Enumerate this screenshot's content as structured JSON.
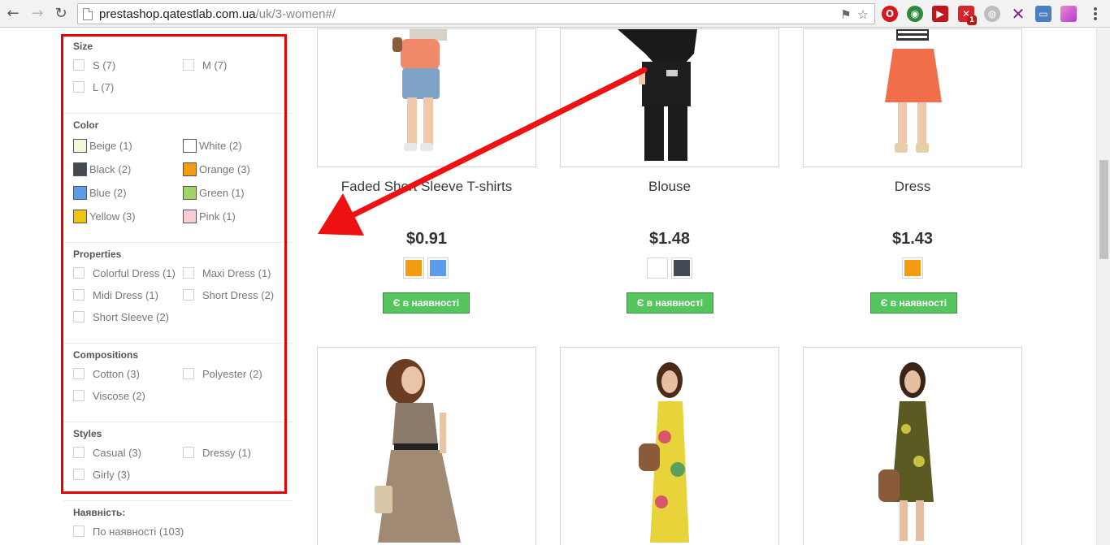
{
  "browser": {
    "url_host": "prestashop.qatestlab.com.ua",
    "url_path": "/uk/3-women#/",
    "back_icon": "arrow-left-icon",
    "forward_icon": "arrow-right-icon",
    "reload_icon": "reload-icon",
    "extensions": [
      {
        "name": "opera-extension-icon",
        "glyph": "O",
        "color": "#d9141d"
      },
      {
        "name": "globe-extension-icon",
        "glyph": "●",
        "color": "#2e8b3e"
      },
      {
        "name": "media-extension-icon",
        "glyph": "▶",
        "color": "#c0171f"
      },
      {
        "name": "blocker-extension-icon",
        "glyph": "✕",
        "color": "#d6252b"
      },
      {
        "name": "world-extension-icon",
        "glyph": "◍",
        "color": "#8a8a8a"
      },
      {
        "name": "cross-extension-icon",
        "glyph": "✕",
        "color": "#8b1c8b"
      },
      {
        "name": "window-extension-icon",
        "glyph": "▭",
        "color": "#4a7fc2"
      },
      {
        "name": "gradient-extension-icon",
        "glyph": "",
        "color": "#d65cb0"
      }
    ],
    "badge_count": "1"
  },
  "filters": {
    "size": {
      "title": "Size",
      "options": [
        "S (7)",
        "M (7)",
        "L (7)"
      ]
    },
    "color": {
      "title": "Color",
      "options": [
        {
          "label": "Beige (1)",
          "color": "#f5f5dc"
        },
        {
          "label": "White (2)",
          "color": "#ffffff"
        },
        {
          "label": "Black (2)",
          "color": "#434a54"
        },
        {
          "label": "Orange (3)",
          "color": "#f39c11"
        },
        {
          "label": "Blue (2)",
          "color": "#5d9cec"
        },
        {
          "label": "Green (1)",
          "color": "#a0d468"
        },
        {
          "label": "Yellow (3)",
          "color": "#f1c40f"
        },
        {
          "label": "Pink (1)",
          "color": "#fcccd3"
        }
      ]
    },
    "properties": {
      "title": "Properties",
      "options": [
        "Colorful Dress (1)",
        "Maxi Dress (1)",
        "Midi Dress (1)",
        "Short Dress (2)",
        "Short Sleeve (2)"
      ]
    },
    "compositions": {
      "title": "Compositions",
      "options": [
        "Cotton (3)",
        "Polyester (2)",
        "Viscose (2)"
      ]
    },
    "styles": {
      "title": "Styles",
      "options": [
        "Casual (3)",
        "Dressy (1)",
        "Girly (3)"
      ]
    },
    "availability": {
      "title": "Наявність:",
      "options": [
        "По наявності (103)"
      ]
    }
  },
  "products": [
    {
      "name": "Faded Short Sleeve T-shirts",
      "price": "$0.91",
      "colors": [
        "#f39c11",
        "#5d9cec"
      ],
      "availability": "Є в наявності"
    },
    {
      "name": "Blouse",
      "price": "$1.48",
      "colors": [
        "#ffffff",
        "#434a54"
      ],
      "availability": "Є в наявності"
    },
    {
      "name": "Dress",
      "price": "$1.43",
      "colors": [
        "#f39c11"
      ],
      "availability": "Є в наявності"
    }
  ],
  "annotation": {
    "highlight_color": "#e00000",
    "arrow_color": "#ee1111"
  }
}
